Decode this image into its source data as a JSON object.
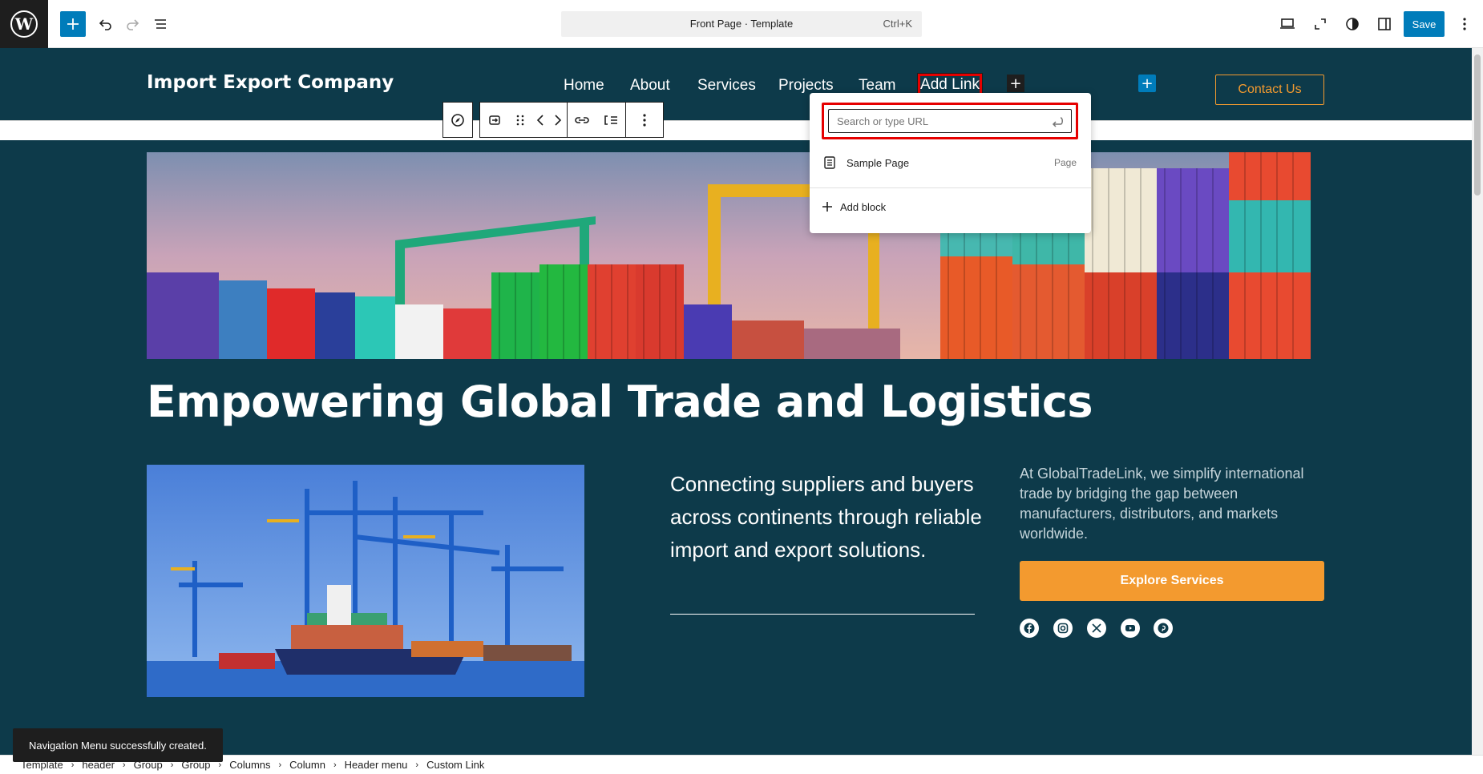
{
  "toolbar": {
    "command_title": "Front Page · Template",
    "command_shortcut": "Ctrl+K",
    "save_label": "Save"
  },
  "header": {
    "site_title": "Import Export Company",
    "nav": [
      "Home",
      "About",
      "Services",
      "Projects",
      "Team"
    ],
    "add_link_label": "Add Link",
    "contact_label": "Contact Us"
  },
  "link_popover": {
    "search_placeholder": "Search or type URL",
    "suggestion_title": "Sample Page",
    "suggestion_type": "Page",
    "add_block_label": "Add block"
  },
  "hero": {
    "headline": "Empowering Global Trade and Logistics",
    "lead": "Connecting suppliers and buyers across continents through reliable import and export solutions.",
    "description": "At GlobalTradeLink, we simplify international trade by bridging the gap between manufacturers, distributors, and markets worldwide.",
    "cta_label": "Explore Services"
  },
  "breadcrumb": [
    "Template",
    "header",
    "Group",
    "Group",
    "Columns",
    "Column",
    "Header menu",
    "Custom Link"
  ],
  "snackbar": "Navigation Menu successfully created.",
  "colors": {
    "header_bg": "#0d3a4a",
    "accent_orange": "#f39a2f",
    "wp_blue": "#007cba",
    "highlight_red": "#e60000"
  },
  "icons": {
    "social": [
      "facebook-icon",
      "instagram-icon",
      "x-icon",
      "youtube-icon",
      "pinterest-icon"
    ]
  }
}
